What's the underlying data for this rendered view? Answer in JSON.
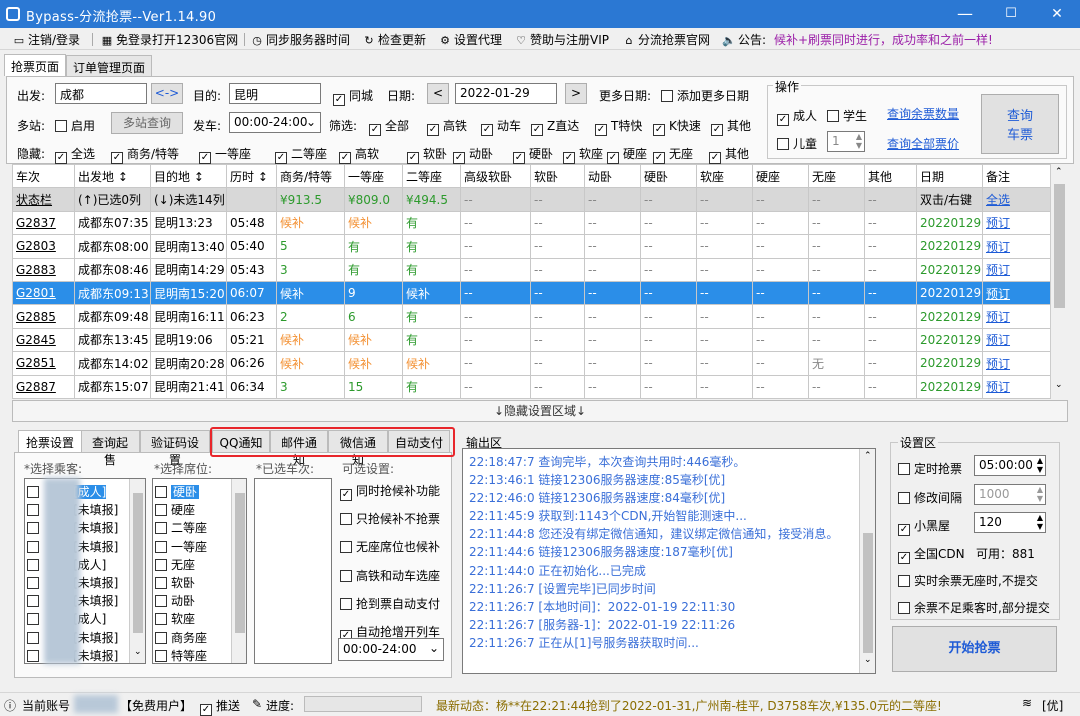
{
  "window": {
    "title": "Bypass-分流抢票--Ver1.14.90",
    "minimize": "—",
    "maximize": "☐",
    "close": "✕"
  },
  "menu": [
    {
      "icon": "monitor-icon",
      "glyph": "▭",
      "label": "注销/登录"
    },
    {
      "icon": "grid-icon",
      "glyph": "▦",
      "label": "免登录打开12306官网"
    },
    {
      "icon": "clock-icon",
      "glyph": "◷",
      "label": "同步服务器时间"
    },
    {
      "icon": "refresh-icon",
      "glyph": "↻",
      "label": "检查更新"
    },
    {
      "icon": "gear-icon",
      "glyph": "⚙",
      "label": "设置代理"
    },
    {
      "icon": "heart-icon",
      "glyph": "♡",
      "label": "赞助与注册VIP"
    },
    {
      "icon": "home-icon",
      "glyph": "⌂",
      "label": "分流抢票官网"
    },
    {
      "icon": "speaker-icon",
      "glyph": "🔈",
      "label": "公告:"
    }
  ],
  "announcement": "候补+刷票同时进行，成功率和之前一样!",
  "tabs": [
    "抢票页面",
    "订单管理页面"
  ],
  "search": {
    "from_label": "出发:",
    "from_value": "成都",
    "swap": "<->",
    "to_label": "目的:",
    "to_value": "昆明",
    "same_city": "同城",
    "date_label": "日期:",
    "date_prev": "<",
    "date_value": "2022-01-29",
    "date_next": ">",
    "more_dates_label": "更多日期:",
    "add_dates": "添加更多日期",
    "multi_label": "多站:",
    "multi_enable": "启用",
    "multi_query": "多站查询",
    "depart_label": "发车:",
    "depart_value": "00:00-24:00",
    "filter_label": "筛选:",
    "filters": [
      "全部",
      "高铁",
      "动车",
      "Z直达",
      "T特快",
      "K快速",
      "其他"
    ],
    "hide_label": "隐藏:",
    "hides": [
      "全选",
      "商务/特等",
      "一等座",
      "二等座",
      "高软",
      "软卧",
      "动卧",
      "硬卧",
      "软座",
      "硬座",
      "无座",
      "其他"
    ]
  },
  "ops": {
    "title": "操作",
    "adult": "成人",
    "student": "学生",
    "child": "儿童",
    "child_count": "1",
    "query_remain": "查询余票数量",
    "query_price": "查询全部票价",
    "query_btn_l1": "查询",
    "query_btn_l2": "车票"
  },
  "table": {
    "headers": [
      "车次",
      "出发地 ↕",
      "目的地 ↕",
      "历时 ↕",
      "商务/特等",
      "一等座",
      "二等座",
      "高级软卧",
      "软卧",
      "动卧",
      "硬卧",
      "软座",
      "硬座",
      "无座",
      "其他",
      "日期",
      "备注"
    ],
    "status_row": [
      "状态栏",
      "(↑)已选0列",
      "(↓)未选14列",
      "",
      "¥913.5",
      "¥809.0",
      "¥494.5",
      "--",
      "--",
      "--",
      "--",
      "--",
      "--",
      "--",
      "--",
      "双击/右键",
      "全选"
    ],
    "rows": [
      [
        "G2837",
        "成都东07:35",
        "昆明13:23",
        "05:48",
        "候补",
        "候补",
        "有",
        "--",
        "--",
        "--",
        "--",
        "--",
        "--",
        "--",
        "--",
        "20220129",
        "预订"
      ],
      [
        "G2803",
        "成都东08:00",
        "昆明南13:40",
        "05:40",
        "5",
        "有",
        "有",
        "--",
        "--",
        "--",
        "--",
        "--",
        "--",
        "--",
        "--",
        "20220129",
        "预订"
      ],
      [
        "G2883",
        "成都东08:46",
        "昆明南14:29",
        "05:43",
        "3",
        "有",
        "有",
        "--",
        "--",
        "--",
        "--",
        "--",
        "--",
        "--",
        "--",
        "20220129",
        "预订"
      ],
      [
        "G2801",
        "成都东09:13",
        "昆明南15:20",
        "06:07",
        "候补",
        "9",
        "候补",
        "--",
        "--",
        "--",
        "--",
        "--",
        "--",
        "--",
        "--",
        "20220129",
        "预订"
      ],
      [
        "G2885",
        "成都东09:48",
        "昆明南16:11",
        "06:23",
        "2",
        "6",
        "有",
        "--",
        "--",
        "--",
        "--",
        "--",
        "--",
        "--",
        "--",
        "20220129",
        "预订"
      ],
      [
        "G2845",
        "成都东13:45",
        "昆明19:06",
        "05:21",
        "候补",
        "候补",
        "有",
        "--",
        "--",
        "--",
        "--",
        "--",
        "--",
        "--",
        "--",
        "20220129",
        "预订"
      ],
      [
        "G2851",
        "成都东14:02",
        "昆明南20:28",
        "06:26",
        "候补",
        "候补",
        "候补",
        "--",
        "--",
        "--",
        "--",
        "--",
        "--",
        "无",
        "--",
        "20220129",
        "预订"
      ],
      [
        "G2887",
        "成都东15:07",
        "昆明南21:41",
        "06:34",
        "3",
        "15",
        "有",
        "--",
        "--",
        "--",
        "--",
        "--",
        "--",
        "--",
        "--",
        "20220129",
        "预订"
      ]
    ]
  },
  "hidden_bar": "↓隐藏设置区域↓",
  "settings_tabs": [
    "抢票设置",
    "查询起售",
    "验证码设置",
    "QQ通知",
    "邮件通知",
    "微信通知",
    "自动支付"
  ],
  "passengers": {
    "label": "*选择乘客:",
    "items": [
      "[成人]",
      "[未填报]",
      "[未填报]",
      "[未填报]",
      "[成人]",
      "[未填报]",
      "[未填报]",
      "[成人]",
      "[未填报]",
      "[未填报]"
    ]
  },
  "seats": {
    "label": "*选择席位:",
    "items": [
      "硬卧",
      "硬座",
      "二等座",
      "一等座",
      "无座",
      "软卧",
      "动卧",
      "软座",
      "商务座",
      "特等座"
    ]
  },
  "trains": {
    "label": "*已选车次:"
  },
  "options": {
    "label": "可选设置:",
    "items": [
      {
        "text": "同时抢候补功能",
        "checked": true
      },
      {
        "text": "只抢候补不抢票",
        "checked": false
      },
      {
        "text": "无座席位也候补",
        "checked": false
      },
      {
        "text": "高铁和动车选座",
        "checked": false
      },
      {
        "text": "抢到票自动支付",
        "checked": false
      },
      {
        "text": "自动抢增开列车",
        "checked": true
      }
    ],
    "time_value": "00:00-24:00"
  },
  "output": {
    "label": "输出区",
    "lines": [
      "22:18:47:7  查询完毕，本次查询共用时:446毫秒。",
      "22:13:46:1  链接12306服务器速度:85毫秒[优]",
      "22:12:46:0  链接12306服务器速度:84毫秒[优]",
      "22:11:45:9  获取到:1143个CDN,开始智能测速中...",
      "22:11:44:8  您还没有绑定微信通知，建议绑定微信通知，接受消息。",
      "22:11:44:6  链接12306服务器速度:187毫秒[优]",
      "22:11:44:0  正在初始化...已完成",
      "22:11:26:7  [设置完毕]已同步时间",
      "22:11:26:7  [本地时间]：2022-01-19 22:11:30",
      "22:11:26:7  [服务器-1]：2022-01-19 22:11:26",
      "22:11:26:7  正在从[1]号服务器获取时间..."
    ]
  },
  "settings": {
    "label": "设置区",
    "timed": "定时抢票",
    "timed_value": "05:00:00",
    "interval": "修改间隔",
    "interval_value": "1000",
    "blackroom": "小黑屋",
    "blackroom_value": "120",
    "cdn": "全国CDN",
    "cdn_avail": "可用：881",
    "realtime": "实时余票无座时,不提交",
    "partial": "余票不足乘客时,部分提交",
    "start": "开始抢票"
  },
  "statusbar": {
    "account_label": "当前账号",
    "user_type": "【免费用户】",
    "push": "推送",
    "progress": "进度:",
    "news": "最新动态：杨**在22:21:44抢到了2022-01-31,广州南-桂平, D3758车次,¥135.0元的二等座!",
    "signal": "[优]"
  },
  "colors": {
    "titlebar": "#2b78d3",
    "selected_row": "#2b8ee8",
    "green": "#2c9a2c",
    "orange": "#f39032",
    "link": "#1e5bd6",
    "highlight_border": "#e8262b"
  }
}
